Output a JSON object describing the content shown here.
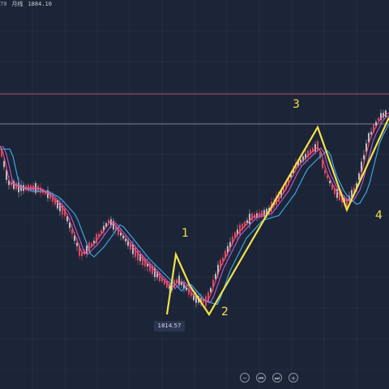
{
  "header": {
    "symbol_text": "70",
    "period_text": "月线",
    "price_text": "1884.10"
  },
  "chart_data": {
    "type": "line",
    "low_marker": "1814.57",
    "wave_labels": [
      "1",
      "2",
      "3",
      "4"
    ],
    "colors": {
      "background": "#1c2437",
      "grid": "#39445a",
      "highlight_line": "#a8566b",
      "wave": "#f2e24a",
      "ma_fast": "#ff5a6e",
      "ma_mid": "#b060d8",
      "ma_slow": "#3aa7e0",
      "candle_up": "#ff4d6a",
      "candle_down": "#d8d8e0"
    }
  },
  "toolbar": {
    "buttons": [
      {
        "name": "zoom-out-button",
        "icon": "minus-icon",
        "glyph": "−"
      },
      {
        "name": "rewind-button",
        "icon": "rewind-icon",
        "glyph": "⏮"
      },
      {
        "name": "forward-button",
        "icon": "forward-icon",
        "glyph": "⏭"
      },
      {
        "name": "zoom-in-button",
        "icon": "plus-icon",
        "glyph": "+"
      }
    ]
  }
}
